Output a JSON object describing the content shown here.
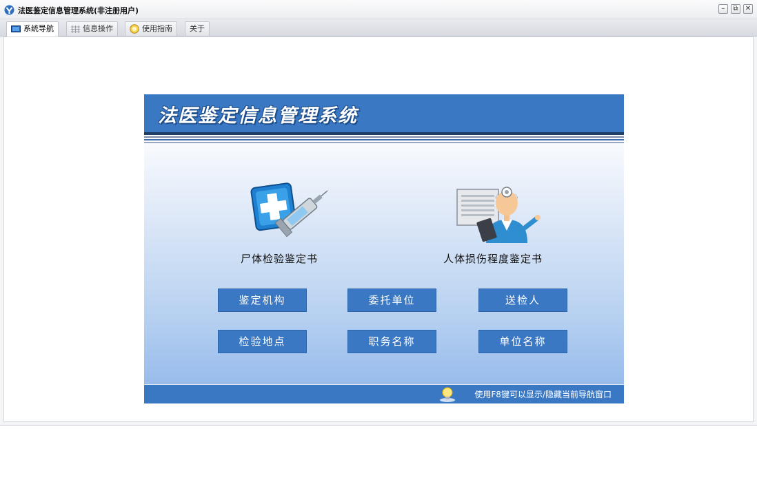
{
  "window": {
    "title": "法医鉴定信息管理系统(非注册用户)",
    "controls": {
      "minimize": "–",
      "restore": "⧉",
      "close": "✕"
    }
  },
  "tabs": [
    {
      "label": "系统导航",
      "icon": "monitor-icon",
      "active": true
    },
    {
      "label": "信息操作",
      "icon": "grid-icon",
      "active": false
    },
    {
      "label": "使用指南",
      "icon": "guide-icon",
      "active": false
    },
    {
      "label": "关于",
      "icon": "",
      "active": false
    }
  ],
  "panel": {
    "banner_title": "法医鉴定信息管理系统",
    "features": [
      {
        "label": "尸体检验鉴定书",
        "icon": "medical-syringe-icon"
      },
      {
        "label": "人体损伤程度鉴定书",
        "icon": "doctor-icon"
      }
    ],
    "buttons": [
      {
        "label": "鉴定机构"
      },
      {
        "label": "委托单位"
      },
      {
        "label": "送检人"
      },
      {
        "label": "检验地点"
      },
      {
        "label": "职务名称"
      },
      {
        "label": "单位名称"
      }
    ],
    "footer_hint": "使用F8键可以显示/隐藏当前导航窗口"
  },
  "colors": {
    "accent": "#3a78c4",
    "panel_bottom": "#8fb6ea"
  }
}
